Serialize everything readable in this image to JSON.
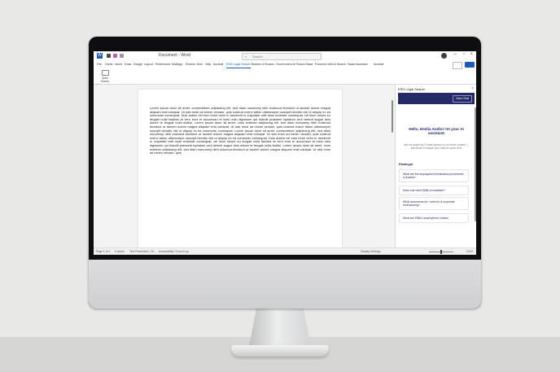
{
  "word": {
    "title": "Document - Word",
    "search_placeholder": "Search",
    "tabs": [
      "File",
      "Home",
      "Insert",
      "Draw",
      "Design",
      "Layout",
      "References",
      "Mailings",
      "Review",
      "View",
      "Help",
      "Acrobat",
      "ESH Legal Search",
      "Bulletin of Exams",
      "Government AI Search Base",
      "Powered with AI Search",
      "Naavi Assistant",
      "Acrobat"
    ],
    "active_tab": "ESH Legal Search",
    "ribbon_button": "Open Search",
    "ribbon_group": "ESH Legal Search",
    "page_text": "Lorem ipsum dolor sit amet, consectetuer adipiscing elit, sed diam nonummy nibh euismod tincidunt ut laoreet dolore magna aliquam erat volutpat. Ut wisi enim ad minim veniam, quis nostrud exerci tation ullamcorper suscipit lobortis nisl ut aliquip ex ea commodo consequat. Duis autem vel eum iriure dolor in hendrerit in vulputate velit esse molestie consequat, vel illum dolore eu feugiat nulla facilisis at vero eros et accumsan et iusto odio dignissim qui blandit praesent luptatum zzril delenit augue duis dolore te feugait nulla facilisi. Lorem ipsum dolor sit amet, cons ectetuer adipiscing elit, sed diam nonummy nibh euismod tincidunt ut laoreet dolore magna aliquam erat volutpat. Ut wisi enim ad minim veniam, quis nostrud exerci tation ullamcorper suscipit lobortis nisl ut aliquip ex ea commodo consequat. Lorem ipsum dolor sit amet, consectetuer adipiscing elit, sed diam nonummy nibh euismod tincidunt ut laoreet dolore magna aliquam erat volutpat. Ut wisi enim ad minim veniam, quis nostrud exerci tation ullamcorper suscipit lobortis nisl ut aliquip ex ea commodo consequat. Duis autem vel eum iriure dolor in hendrerit in vulputate velit esse molestie consequat, vel illum dolore eu feugiat nulla facilisis at vero eros et accumsan et iusto odio dignissim qui blandit praesent luptatum zzril delenit augue duis dolore te feugait nulla facilisi. Lorem ipsum dolor sit amet, cons ectetuer adipiscing elit, sed diam nonummy nibh euismod tincidunt ut laoreet dolore magna aliquam erat volutpat. Ut wisi enim ad minim veniam, quis"
  },
  "pane": {
    "title": "ESH Legal Search",
    "close_glyph": "×",
    "header_button": "New Chat",
    "greeting": "Hello, Emilia Andlo! I'm your AI assistant",
    "greeting_sub": "Ask me anything! I'll have access to our entire content — ask below to ensure your chat for quick view",
    "section_label": "Paralegal",
    "suggestions": [
      "What are the employment termination procedures in Austria?",
      "Does one need Willis to establish?",
      "What documents do I need for a corporate restructuring?",
      "What are EWA's employment notices"
    ]
  },
  "status": {
    "page": "Page 1 of 1",
    "words": "0 words",
    "text_predictions": "Text Predictions: On",
    "accessibility": "Accessibility: Good to go",
    "focus": "Display Settings",
    "zoom": "110%"
  },
  "colors": {
    "word_blue": "#185abd",
    "pane_navy": "#242a66"
  }
}
